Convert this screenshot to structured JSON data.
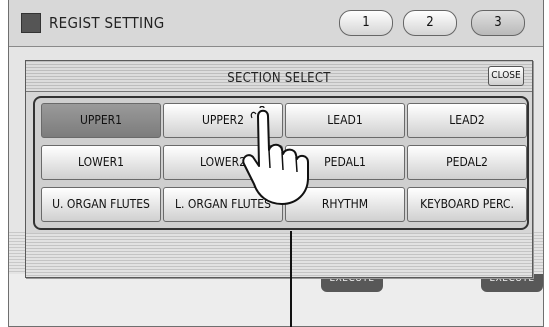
{
  "window": {
    "title": "REGIST SETTING"
  },
  "tabs": [
    {
      "label": "1",
      "active": false
    },
    {
      "label": "2",
      "active": false
    },
    {
      "label": "3",
      "active": true
    }
  ],
  "dialog": {
    "title": "SECTION SELECT",
    "close_label": "CLOSE",
    "buttons": [
      {
        "label": "UPPER1",
        "selected": true
      },
      {
        "label": "UPPER2",
        "selected": false
      },
      {
        "label": "LEAD1",
        "selected": false
      },
      {
        "label": "LEAD2",
        "selected": false
      },
      {
        "label": "LOWER1",
        "selected": false
      },
      {
        "label": "LOWER2",
        "selected": false
      },
      {
        "label": "PEDAL1",
        "selected": false
      },
      {
        "label": "PEDAL2",
        "selected": false
      },
      {
        "label": "U. ORGAN FLUTES",
        "selected": false
      },
      {
        "label": "L. ORGAN FLUTES",
        "selected": false
      },
      {
        "label": "RHYTHM",
        "selected": false
      },
      {
        "label": "KEYBOARD PERC.",
        "selected": false
      }
    ]
  },
  "background": {
    "execute_labels": [
      "EXECUTE",
      "EXECUTE"
    ]
  },
  "colors": {
    "selected_button": "#8a8a8a",
    "panel": "#d6d6d6",
    "frame": "#333333"
  }
}
